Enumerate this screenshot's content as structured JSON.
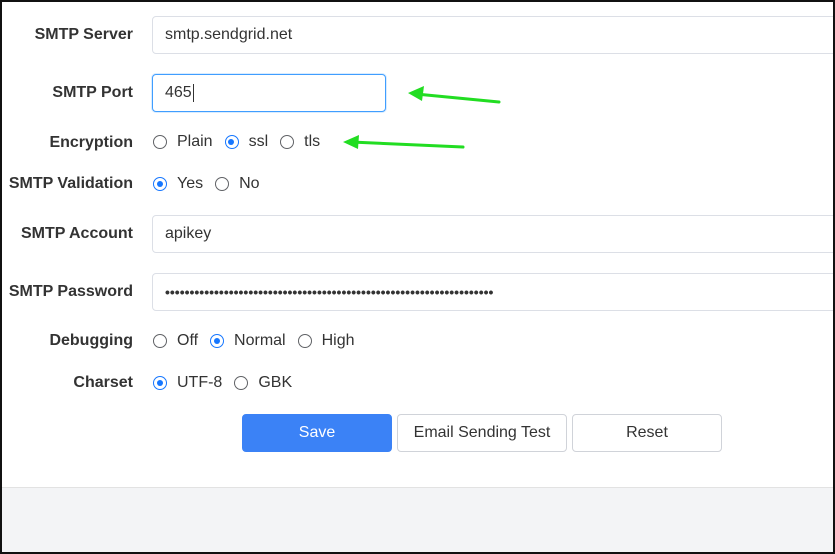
{
  "form": {
    "smtp_server": {
      "label": "SMTP Server",
      "value": "smtp.sendgrid.net"
    },
    "smtp_port": {
      "label": "SMTP Port",
      "value": "465"
    },
    "encryption": {
      "label": "Encryption",
      "options": [
        "Plain",
        "ssl",
        "tls"
      ],
      "selected": "ssl"
    },
    "smtp_validation": {
      "label": "SMTP Validation",
      "options": [
        "Yes",
        "No"
      ],
      "selected": "Yes"
    },
    "smtp_account": {
      "label": "SMTP Account",
      "value": "apikey"
    },
    "smtp_password": {
      "label": "SMTP Password",
      "value": "•••••••••••••••••••••••••••••••••••••••••••••••••••••••••••••••••••"
    },
    "debugging": {
      "label": "Debugging",
      "options": [
        "Off",
        "Normal",
        "High"
      ],
      "selected": "Normal"
    },
    "charset": {
      "label": "Charset",
      "options": [
        "UTF-8",
        "GBK"
      ],
      "selected": "UTF-8"
    }
  },
  "buttons": {
    "save": "Save",
    "email_test": "Email Sending Test",
    "reset": "Reset"
  },
  "colors": {
    "primary": "#3b82f6",
    "radio_checked": "#1677ff",
    "annotation_arrow": "#22dd22"
  }
}
